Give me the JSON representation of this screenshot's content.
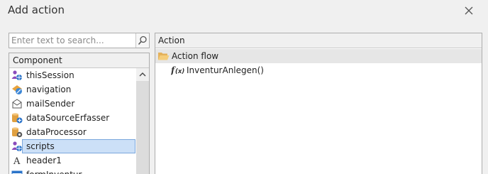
{
  "dialog": {
    "title": "Add action"
  },
  "search": {
    "placeholder": "Enter text to search..."
  },
  "component_panel": {
    "header": "Component",
    "items": [
      {
        "label": "thisSession",
        "icon": "session-user-icon"
      },
      {
        "label": "navigation",
        "icon": "navigation-icon"
      },
      {
        "label": "mailSender",
        "icon": "mail-sender-icon"
      },
      {
        "label": "dataSourceErfasser",
        "icon": "data-source-icon"
      },
      {
        "label": "dataProcessor",
        "icon": "data-processor-icon"
      },
      {
        "label": "scripts",
        "icon": "scripts-icon",
        "selected": true
      },
      {
        "label": "header1",
        "icon": "text-label-icon"
      },
      {
        "label": "formInventur",
        "icon": "form-icon"
      }
    ]
  },
  "action_panel": {
    "header": "Action",
    "group": {
      "label": "Action flow",
      "icon": "folder-open-icon"
    },
    "functions": [
      {
        "label": "InventurAnlegen()",
        "icon": "function-icon"
      }
    ]
  },
  "colors": {
    "selection_bg": "#cce0f7",
    "selection_border": "#7aa7dd",
    "group_row_bg": "#e6e6e6",
    "window_bg": "#f0f0f0"
  }
}
